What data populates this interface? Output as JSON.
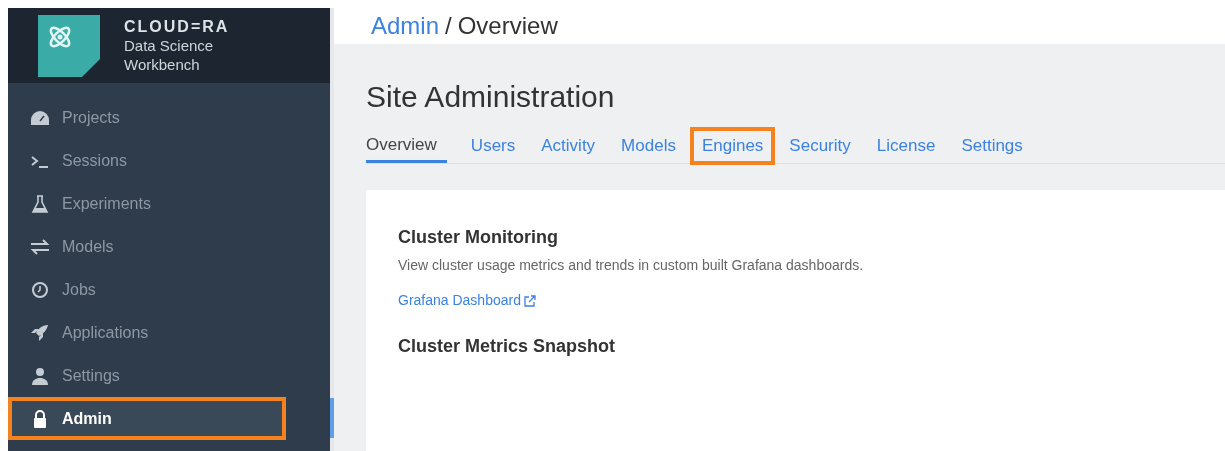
{
  "logo": {
    "brand": "CLOUD=RA",
    "product": "Data Science",
    "product_line2": "Workbench"
  },
  "sidebar": {
    "items": [
      {
        "label": "Projects",
        "selected": false,
        "highlighted": false
      },
      {
        "label": "Sessions",
        "selected": false,
        "highlighted": false
      },
      {
        "label": "Experiments",
        "selected": false,
        "highlighted": false
      },
      {
        "label": "Models",
        "selected": false,
        "highlighted": false
      },
      {
        "label": "Jobs",
        "selected": false,
        "highlighted": false
      },
      {
        "label": "Applications",
        "selected": false,
        "highlighted": false
      },
      {
        "label": "Settings",
        "selected": false,
        "highlighted": false
      },
      {
        "label": "Admin",
        "selected": true,
        "highlighted": true
      }
    ]
  },
  "breadcrumb": {
    "link": "Admin",
    "separator": "/",
    "current": "Overview"
  },
  "page_title": "Site Administration",
  "tabs": [
    {
      "label": "Overview",
      "selected": true,
      "highlighted": false
    },
    {
      "label": "Users",
      "selected": false,
      "highlighted": false
    },
    {
      "label": "Activity",
      "selected": false,
      "highlighted": false
    },
    {
      "label": "Models",
      "selected": false,
      "highlighted": false
    },
    {
      "label": "Engines",
      "selected": false,
      "highlighted": true
    },
    {
      "label": "Security",
      "selected": false,
      "highlighted": false
    },
    {
      "label": "License",
      "selected": false,
      "highlighted": false
    },
    {
      "label": "Settings",
      "selected": false,
      "highlighted": false
    }
  ],
  "card": {
    "sections": [
      {
        "title": "Cluster Monitoring",
        "description": "View cluster usage metrics and trends in custom built Grafana dashboards.",
        "link": "Grafana Dashboard"
      },
      {
        "title": "Cluster Metrics Snapshot"
      }
    ]
  }
}
